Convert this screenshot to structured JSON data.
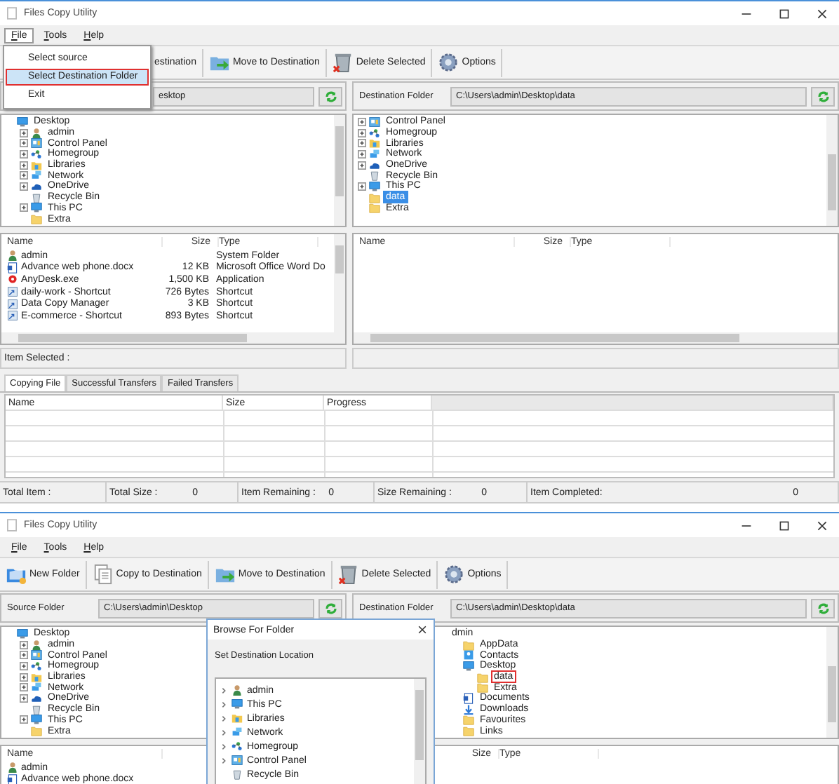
{
  "windows": [
    {
      "title": "Files Copy Utility",
      "menu": [
        {
          "label": "File",
          "selected": true
        },
        {
          "label": "Tools",
          "selected": false
        },
        {
          "label": "Help",
          "selected": false
        }
      ],
      "file_menu": {
        "items": [
          {
            "label": "Select source",
            "selected": false
          },
          {
            "label": "Select Destination Folder",
            "selected": true
          },
          {
            "label": "Exit",
            "selected": false
          }
        ]
      },
      "toolbar": [
        {
          "kind": "text",
          "label": "estination"
        },
        {
          "kind": "move",
          "label": "Move to Destination"
        },
        {
          "kind": "delete",
          "label": "Delete Selected"
        },
        {
          "kind": "options",
          "label": "Options"
        }
      ],
      "source": {
        "path": "esktop",
        "tree": {
          "items": [
            {
              "label": "Desktop",
              "kind": "desktop",
              "expandable": false,
              "selected": false,
              "children": [
                {
                  "label": "admin",
                  "kind": "user",
                  "expandable": true,
                  "selected": false
                },
                {
                  "label": "Control Panel",
                  "kind": "control-panel",
                  "expandable": true,
                  "selected": false
                },
                {
                  "label": "Homegroup",
                  "kind": "homegroup",
                  "expandable": true,
                  "selected": false
                },
                {
                  "label": "Libraries",
                  "kind": "library",
                  "expandable": true,
                  "selected": false
                },
                {
                  "label": "Network",
                  "kind": "network",
                  "expandable": true,
                  "selected": false
                },
                {
                  "label": "OneDrive",
                  "kind": "cloud",
                  "expandable": true,
                  "selected": false
                },
                {
                  "label": "Recycle Bin",
                  "kind": "recycle-bin",
                  "expandable": false,
                  "selected": false
                },
                {
                  "label": "This PC",
                  "kind": "computer",
                  "expandable": true,
                  "selected": false
                },
                {
                  "label": "Extra",
                  "kind": "folder",
                  "expandable": false,
                  "selected": false
                }
              ]
            }
          ]
        },
        "list": {
          "columns": [
            {
              "kind": "name",
              "label": "Name"
            },
            {
              "kind": "size",
              "label": "Size"
            },
            {
              "kind": "type",
              "label": "Type"
            }
          ],
          "rows": [
            {
              "kind": "user",
              "name": "admin",
              "type": "System Folder"
            },
            {
              "kind": "document",
              "name": "Advance web phone.docx",
              "size": "12 KB",
              "type": "Microsoft Office Word Do"
            },
            {
              "kind": "app",
              "name": "AnyDesk.exe",
              "size": "1,500 KB",
              "type": "Application"
            },
            {
              "kind": "shortcut",
              "name": "daily-work - Shortcut",
              "size": "726 Bytes",
              "type": "Shortcut"
            },
            {
              "kind": "shortcut",
              "name": "Data Copy Manager",
              "size": "3 KB",
              "type": "Shortcut"
            },
            {
              "kind": "shortcut",
              "name": "E-commerce - Shortcut",
              "size": "893 Bytes",
              "type": "Shortcut"
            }
          ]
        },
        "item_selected": "Item Selected :"
      },
      "destination": {
        "label": "Destination Folder",
        "path": "C:\\Users\\admin\\Desktop\\data",
        "tree": {
          "selection_outlined": false,
          "items": [
            {
              "label": "Control Panel",
              "kind": "control-panel",
              "expandable": true,
              "selected": false
            },
            {
              "label": "Homegroup",
              "kind": "homegroup",
              "expandable": true,
              "selected": false
            },
            {
              "label": "Libraries",
              "kind": "library",
              "expandable": true,
              "selected": false
            },
            {
              "label": "Network",
              "kind": "network",
              "expandable": true,
              "selected": false
            },
            {
              "label": "OneDrive",
              "kind": "cloud",
              "expandable": true,
              "selected": false
            },
            {
              "label": "Recycle Bin",
              "kind": "recycle-bin",
              "expandable": false,
              "selected": false
            },
            {
              "label": "This PC",
              "kind": "computer",
              "expandable": true,
              "selected": false
            },
            {
              "label": "data",
              "kind": "folder",
              "expandable": false,
              "selected": true
            },
            {
              "label": "Extra",
              "kind": "folder",
              "expandable": false,
              "selected": false
            }
          ]
        },
        "list": {
          "columns": [
            {
              "kind": "name",
              "label": "Name"
            },
            {
              "kind": "size",
              "label": "Size"
            },
            {
              "kind": "type",
              "label": "Type"
            }
          ]
        }
      },
      "transfers": {
        "tabs": [
          {
            "label": "Copying File",
            "selected": true
          },
          {
            "label": "Successful Transfers",
            "selected": false
          },
          {
            "label": "Failed Transfers",
            "selected": false
          }
        ],
        "columns": [
          "Name",
          "Size",
          "Progress"
        ]
      },
      "status_bar": [
        {
          "label": "Total Item :"
        },
        {
          "label": "Total Size :",
          "value": "0"
        },
        {
          "label": "Item Remaining :",
          "value": "0"
        },
        {
          "label": "Size Remaining :",
          "value": "0"
        },
        {
          "label": "Item Completed:",
          "value": "0"
        }
      ]
    },
    {
      "title": "Files Copy Utility",
      "menu": [
        {
          "label": "File",
          "selected": false
        },
        {
          "label": "Tools",
          "selected": false
        },
        {
          "label": "Help",
          "selected": false
        }
      ],
      "toolbar": [
        {
          "kind": "new-folder",
          "label": "New Folder"
        },
        {
          "kind": "copy",
          "label": "Copy to Destination"
        },
        {
          "kind": "move",
          "label": "Move to Destination"
        },
        {
          "kind": "delete",
          "label": "Delete Selected"
        },
        {
          "kind": "options",
          "label": "Options"
        }
      ],
      "source": {
        "label": "Source Folder",
        "path": "C:\\Users\\admin\\Desktop",
        "tree": {
          "items": [
            {
              "label": "Desktop",
              "kind": "desktop",
              "expandable": false,
              "selected": false,
              "children": [
                {
                  "label": "admin",
                  "kind": "user",
                  "expandable": true,
                  "selected": false
                },
                {
                  "label": "Control Panel",
                  "kind": "control-panel",
                  "expandable": true,
                  "selected": false
                },
                {
                  "label": "Homegroup",
                  "kind": "homegroup",
                  "expandable": true,
                  "selected": false
                },
                {
                  "label": "Libraries",
                  "kind": "library",
                  "expandable": true,
                  "selected": false
                },
                {
                  "label": "Network",
                  "kind": "network",
                  "expandable": true,
                  "selected": false
                },
                {
                  "label": "OneDrive",
                  "kind": "cloud",
                  "expandable": true,
                  "selected": false
                },
                {
                  "label": "Recycle Bin",
                  "kind": "recycle-bin",
                  "expandable": false,
                  "selected": false
                },
                {
                  "label": "This PC",
                  "kind": "computer",
                  "expandable": true,
                  "selected": false
                },
                {
                  "label": "Extra",
                  "kind": "folder",
                  "expandable": false,
                  "selected": false
                }
              ]
            }
          ]
        },
        "list": {
          "columns": [
            {
              "kind": "name",
              "label": "Name"
            }
          ],
          "rows": [
            {
              "kind": "user",
              "name": "admin"
            },
            {
              "kind": "document",
              "name": "Advance web phone.docx"
            }
          ]
        }
      },
      "destination": {
        "label": "Destination Folder",
        "path": "C:\\Users\\admin\\Desktop\\data",
        "tree": {
          "selection_outlined": true,
          "items": [
            {
              "label": "dmin",
              "kind": "text",
              "expandable": false,
              "selected": false,
              "children": [
                {
                  "label": "AppData",
                  "kind": "folder",
                  "expandable": false,
                  "selected": false
                },
                {
                  "label": "Contacts",
                  "kind": "contacts",
                  "expandable": false,
                  "selected": false
                },
                {
                  "label": "Desktop",
                  "kind": "desktop",
                  "expandable": false,
                  "selected": false,
                  "children": [
                    {
                      "label": "data",
                      "kind": "folder",
                      "expandable": false,
                      "selected": true
                    },
                    {
                      "label": "Extra",
                      "kind": "folder",
                      "expandable": false,
                      "selected": false
                    }
                  ]
                },
                {
                  "label": "Documents",
                  "kind": "document",
                  "expandable": false,
                  "selected": false
                },
                {
                  "label": "Downloads",
                  "kind": "download",
                  "expandable": false,
                  "selected": false
                },
                {
                  "label": "Favourites",
                  "kind": "folder",
                  "expandable": false,
                  "selected": false
                },
                {
                  "label": "Links",
                  "kind": "folder",
                  "expandable": false,
                  "selected": false
                }
              ]
            }
          ]
        },
        "list": {
          "columns": [
            {
              "kind": "size",
              "label": "Size"
            },
            {
              "kind": "type",
              "label": "Type"
            }
          ]
        }
      },
      "browse_dialog": {
        "title": "Browse For Folder",
        "prompt": "Set Destination Location",
        "items": [
          {
            "label": "admin",
            "kind": "user",
            "expandable": true
          },
          {
            "label": "This PC",
            "kind": "computer",
            "expandable": true
          },
          {
            "label": "Libraries",
            "kind": "library",
            "expandable": true
          },
          {
            "label": "Network",
            "kind": "network",
            "expandable": true
          },
          {
            "label": "Homegroup",
            "kind": "homegroup",
            "expandable": true
          },
          {
            "label": "Control Panel",
            "kind": "control-panel",
            "expandable": true
          },
          {
            "label": "Recycle Bin",
            "kind": "recycle-bin",
            "expandable": false
          }
        ]
      }
    }
  ]
}
